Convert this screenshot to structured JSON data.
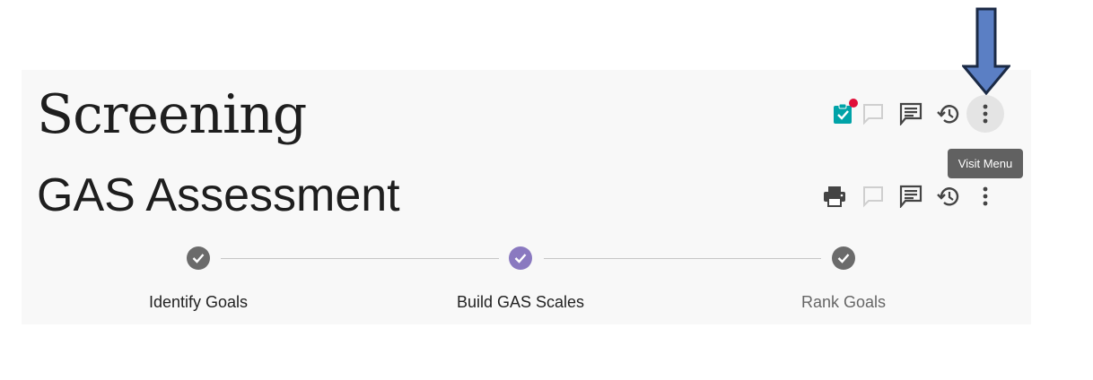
{
  "header": {
    "section_title": "Screening",
    "toolbar_icons": [
      "assignment-check-icon",
      "comment-outline-icon",
      "comments-icon",
      "history-icon",
      "more-vert-icon"
    ],
    "notification_color": "#e0103a",
    "accent_teal": "#00a3a8"
  },
  "form": {
    "title": "GAS Assessment",
    "toolbar_icons": [
      "print-icon",
      "comment-outline-icon",
      "comments-icon",
      "history-icon",
      "more-vert-icon"
    ]
  },
  "tooltip": {
    "text": "Visit Menu"
  },
  "stepper": {
    "steps": [
      {
        "label": "Identify Goals",
        "state": "complete",
        "color": "#6b6b6b"
      },
      {
        "label": "Build GAS Scales",
        "state": "active",
        "color": "#8a79c0"
      },
      {
        "label": "Rank Goals",
        "state": "complete",
        "color": "#6b6b6b"
      }
    ]
  },
  "annotation": {
    "arrow_color": "#5b7fc4",
    "arrow_outline": "#1b2a45"
  }
}
